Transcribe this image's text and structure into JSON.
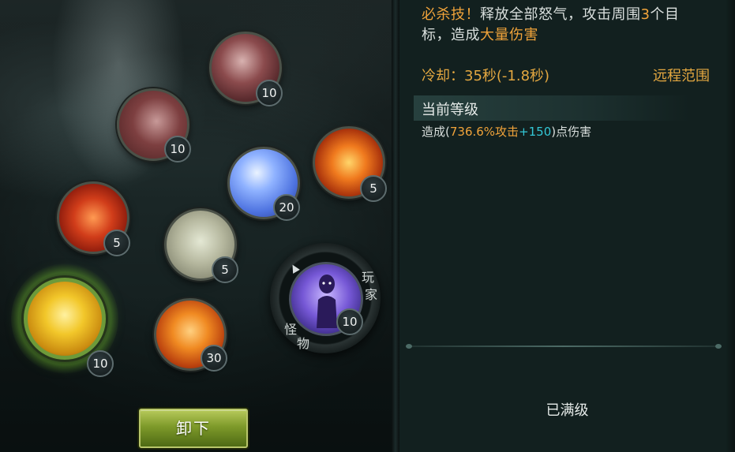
{
  "skill_tree": {
    "skills": [
      {
        "id": "skill-1",
        "level": "10"
      },
      {
        "id": "skill-2",
        "level": "10"
      },
      {
        "id": "skill-3",
        "level": "5"
      },
      {
        "id": "skill-4",
        "level": "20"
      },
      {
        "id": "skill-5",
        "level": "5"
      },
      {
        "id": "skill-6",
        "level": "5"
      },
      {
        "id": "skill-7",
        "level": "30"
      },
      {
        "id": "skill-8",
        "level": "10"
      }
    ],
    "ring": {
      "player_chars": [
        "玩",
        "家"
      ],
      "monster_chars": [
        "怪",
        "物"
      ],
      "level": "10"
    },
    "unequip_label": "卸下"
  },
  "detail": {
    "desc_line1": {
      "prefix": "必杀技！",
      "text1": "释放全部怒气，攻击周围",
      "num": "3",
      "text2": "个目"
    },
    "desc_line2": {
      "text1": "标，造成",
      "highlight": "大量伤害"
    },
    "cooldown": "冷却：35秒(-1.8秒)",
    "range": "远程范围",
    "level_title": "当前等级",
    "effect": {
      "pre": "造成(",
      "value": "736.6%攻击",
      "bonus": "+150",
      "post": ")点伤害"
    },
    "maxed": "已满级"
  },
  "colors": {
    "highlight_orange": "#f0a33a",
    "highlight_cyan": "#33c7d6",
    "button_green": "#7e9a2a"
  }
}
